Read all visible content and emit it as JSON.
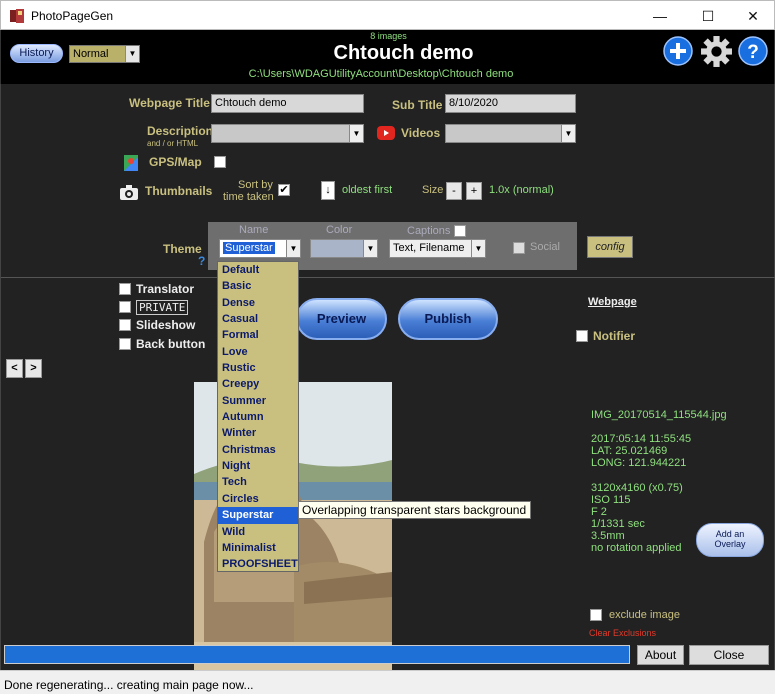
{
  "window": {
    "title": "PhotoPageGen",
    "minimize": "—",
    "maximize": "☐",
    "close": "✕"
  },
  "header": {
    "history_label": "History",
    "mode_value": "Normal",
    "image_count": "8 images",
    "album_title": "Chtouch demo",
    "album_path": "C:\\Users\\WDAGUtilityAccount\\Desktop\\Chtouch demo",
    "icons": [
      "add-icon",
      "gear-icon",
      "help-icon"
    ]
  },
  "form": {
    "webpage_title_label": "Webpage Title",
    "webpage_title_value": "Chtouch demo",
    "subtitle_label": "Sub Title",
    "subtitle_value": "8/10/2020",
    "description_label": "Description",
    "description_hint": "and / or HTML",
    "videos_label": "Videos",
    "gps_label": "GPS/Map",
    "thumbnails_label": "Thumbnails",
    "sort_label_1": "Sort by",
    "sort_label_2": "time taken",
    "sort_checked": true,
    "order_arrow": "↓",
    "order_label": "oldest first",
    "size_label": "Size",
    "size_minus": "-",
    "size_plus": "+",
    "size_value": "1.0x (normal)",
    "theme_label": "Theme",
    "theme_help": "?",
    "name_header": "Name",
    "color_header": "Color",
    "captions_header": "Captions",
    "theme_value": "Superstar",
    "captions_value": "Text, Filename",
    "social_label": "Social",
    "config_label": "config"
  },
  "options": {
    "translator": "Translator",
    "private": "PRIVATE",
    "slideshow": "Slideshow",
    "back_button": "Back button",
    "preview": "Preview",
    "publish": "Publish",
    "webpage_link": "Webpage",
    "notifier": "Notifier",
    "prev": "<",
    "next": ">"
  },
  "theme_list": {
    "items": [
      "Default",
      "Basic",
      "Dense",
      "Casual",
      "Formal",
      "Love",
      "Rustic",
      "Creepy",
      "Summer",
      "Autumn",
      "Winter",
      "Christmas",
      "Night",
      "Tech",
      "Circles",
      "Superstar",
      "Wild",
      "Minimalist",
      "PROOFSHEET"
    ],
    "selected": "Superstar",
    "tooltip": "Overlapping transparent stars background"
  },
  "image_info": {
    "filename": "IMG_20170514_115544.jpg",
    "datetime": "2017:05:14 11:55:45",
    "lat": "LAT: 25.021469",
    "long": "LONG: 121.944221",
    "dimensions": "3120x4160 (x0.75)",
    "iso": "ISO 115",
    "fstop": "F 2",
    "shutter": "1/1331 sec",
    "focal": "3.5mm",
    "rotation": "no rotation applied",
    "exclude_label": "exclude image",
    "clear_exclusions": "Clear Exclusions",
    "overlay_line1": "Add an",
    "overlay_line2": "Overlay"
  },
  "footer": {
    "about": "About",
    "close": "Close",
    "status": "Done regenerating... creating main page now..."
  },
  "colors": {
    "accent_green": "#8fe07f",
    "label_gold": "#c9c080",
    "progress_blue": "#1e6fd6",
    "selection_blue": "#1f60d6"
  }
}
